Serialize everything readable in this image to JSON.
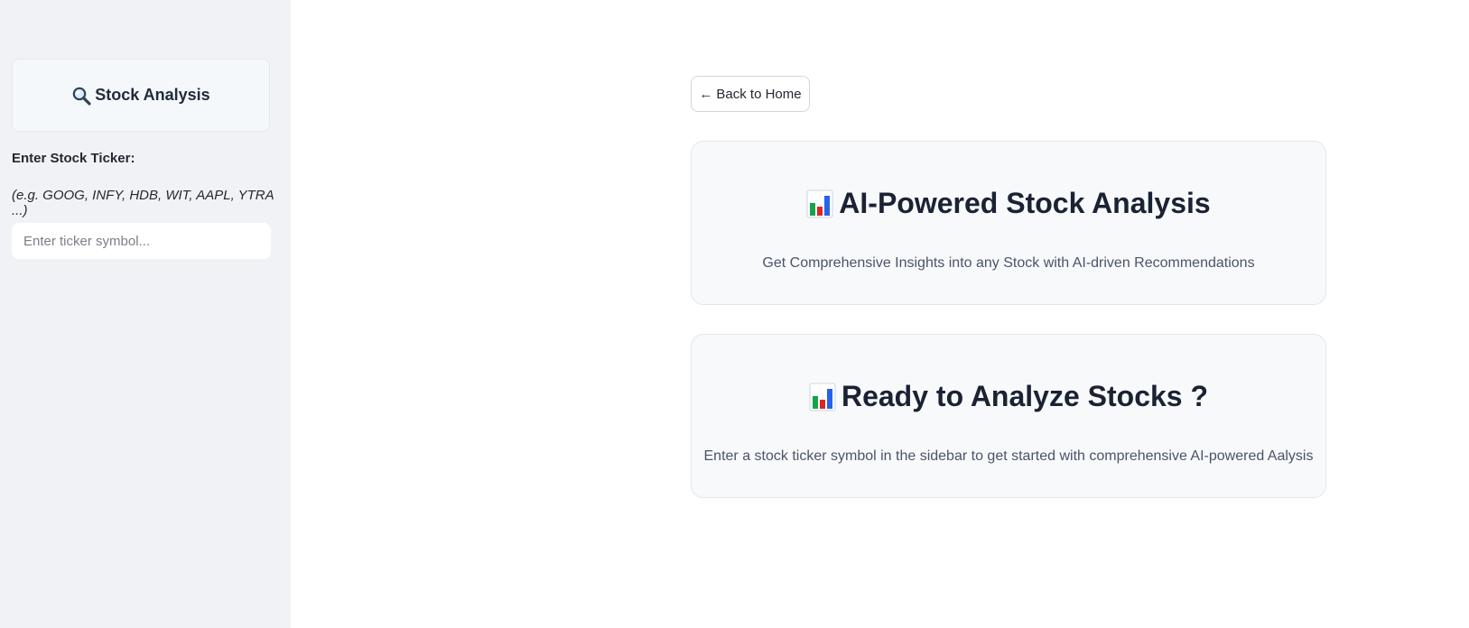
{
  "sidebar": {
    "card_title": "Stock Analysis",
    "card_icon": "search-icon",
    "ticker_label": "Enter Stock Ticker:",
    "ticker_hint": "(e.g. GOOG, INFY, HDB, WIT, AAPL, YTRA ...)",
    "ticker_input": {
      "placeholder": "Enter ticker symbol...",
      "value": ""
    }
  },
  "main": {
    "back_button": {
      "arrow": "←",
      "label": "Back to Home"
    },
    "hero_card": {
      "icon": "bar-chart-icon",
      "title": "AI-Powered Stock Analysis",
      "subtitle": "Get Comprehensive Insights into any Stock with AI-driven Recommendations"
    },
    "ready_card": {
      "icon": "bar-chart-icon",
      "title": "Ready to Analyze Stocks ?",
      "subtitle": "Enter a stock ticker symbol in the sidebar to get started with comprehensive AI-powered Aalysis"
    }
  },
  "colors": {
    "sidebar_bg": "#f0f2f6",
    "card_bg": "#f8f9fb",
    "heading_text": "#1a2233",
    "subtitle_text": "#4a5468"
  }
}
